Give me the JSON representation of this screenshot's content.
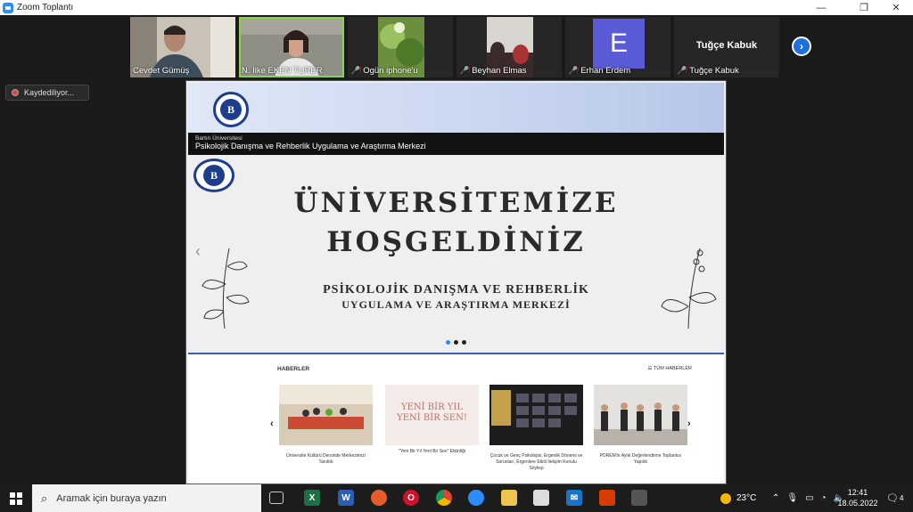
{
  "window": {
    "title": "Zoom Toplantı"
  },
  "participants": [
    {
      "name": "Cevdet Gümüş",
      "muted": false,
      "active": false,
      "kind": "video"
    },
    {
      "name": "N. İlke EKEN TURER",
      "muted": false,
      "active": true,
      "kind": "video"
    },
    {
      "name": "Ogün iphone'u",
      "muted": true,
      "active": false,
      "kind": "video"
    },
    {
      "name": "Beyhan Elmas",
      "muted": true,
      "active": false,
      "kind": "video"
    },
    {
      "name": "Erhan Erdem",
      "muted": true,
      "active": false,
      "kind": "avatar",
      "avatar_letter": "E",
      "avatar_color": "#5b5bd6"
    },
    {
      "name": "Tuğçe Kabuk",
      "muted": true,
      "active": false,
      "kind": "name",
      "display_name": "Tuğçe Kabuk"
    }
  ],
  "recording": {
    "label": "Kaydediliyor..."
  },
  "share": {
    "top_bar": {
      "line1": "Bartın Üniversitesi",
      "line2": "Psikolojik Danışma ve Rehberlik Uygulama ve Araştırma Merkezi"
    },
    "slide": {
      "heading1": "ÜNİVERSİTEMİZE",
      "heading2": "HOŞGELDİNİZ",
      "sub1": "PSİKOLOJİK DANIŞMA VE REHBERLİK",
      "sub2": "UYGULAMA VE ARAŞTIRMA MERKEZİ"
    },
    "news": {
      "heading": "HABERLER",
      "all_link": "☰ TÜM HABERLER",
      "cards": [
        {
          "caption": "Üniversite Kültürü Dersinde Merkezimizi Tanıttık"
        },
        {
          "caption": "\"Yeni Bir Yıl Yeni Bir Sen\" Etkinliği"
        },
        {
          "caption": "Çocuk ve Genç Psikolojisi, Ergenlik Dönemi ve Sorunları, Ergenlere Etkili İletişim Konulu Söyleşi"
        },
        {
          "caption": "PDREM'in Aylık Değerlendirme Toplantısı Yapıldı"
        }
      ],
      "card2_poster": {
        "line1": "YENİ BİR YIL",
        "line2": "YENİ BİR SEN!"
      }
    }
  },
  "taskbar": {
    "search_placeholder": "Aramak için buraya yazın",
    "weather": "23°C",
    "time": "12:41",
    "date": "18.05.2022",
    "notifications": "4"
  }
}
